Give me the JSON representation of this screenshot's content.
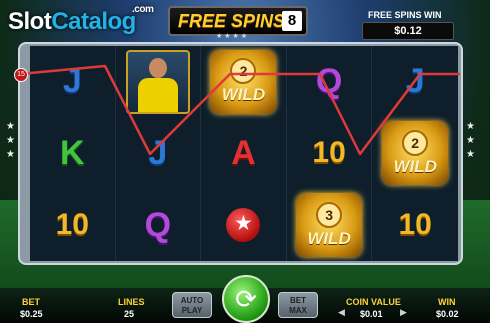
{
  "brand": {
    "logo_main": "Slot",
    "logo_accent": "Catalog",
    "logo_suffix": ".com"
  },
  "header": {
    "banner_title": "FREE SPINS",
    "free_spins_remaining": "8",
    "free_spins_win_label": "FREE SPINS WIN",
    "free_spins_win_value": "$0.12"
  },
  "reels": {
    "rows": [
      [
        {
          "kind": "letter",
          "value": "J",
          "cls": "sym-J"
        },
        {
          "kind": "player"
        },
        {
          "kind": "wild",
          "mult": "2",
          "word": "WILD"
        },
        {
          "kind": "letter",
          "value": "Q",
          "cls": "sym-Q"
        },
        {
          "kind": "letter",
          "value": "J",
          "cls": "sym-J"
        }
      ],
      [
        {
          "kind": "letter",
          "value": "K",
          "cls": "sym-K"
        },
        {
          "kind": "letter",
          "value": "J",
          "cls": "sym-J"
        },
        {
          "kind": "letter",
          "value": "A",
          "cls": "sym-A"
        },
        {
          "kind": "letter",
          "value": "10",
          "cls": "sym-10"
        },
        {
          "kind": "wild",
          "mult": "2",
          "word": "WILD"
        }
      ],
      [
        {
          "kind": "letter",
          "value": "10",
          "cls": "sym-10"
        },
        {
          "kind": "letter",
          "value": "Q",
          "cls": "sym-Q"
        },
        {
          "kind": "ball"
        },
        {
          "kind": "wild",
          "mult": "3",
          "word": "WILD"
        },
        {
          "kind": "letter",
          "value": "10",
          "cls": "sym-10"
        }
      ]
    ],
    "payline_number": "15"
  },
  "controls": {
    "bet_label": "BET",
    "bet_value": "$0.25",
    "lines_label": "LINES",
    "lines_value": "25",
    "autoplay_line1": "AUTO",
    "autoplay_line2": "PLAY",
    "spin_glyph": "⟳",
    "betmax_line1": "BET",
    "betmax_line2": "MAX",
    "coin_value_label": "COIN VALUE",
    "coin_value": "$0.01",
    "win_label": "WIN",
    "win_value": "$0.02"
  },
  "colors": {
    "payline": "#e0393a",
    "gold": "#ffcf2e",
    "accent_blue": "#21b3e8"
  }
}
